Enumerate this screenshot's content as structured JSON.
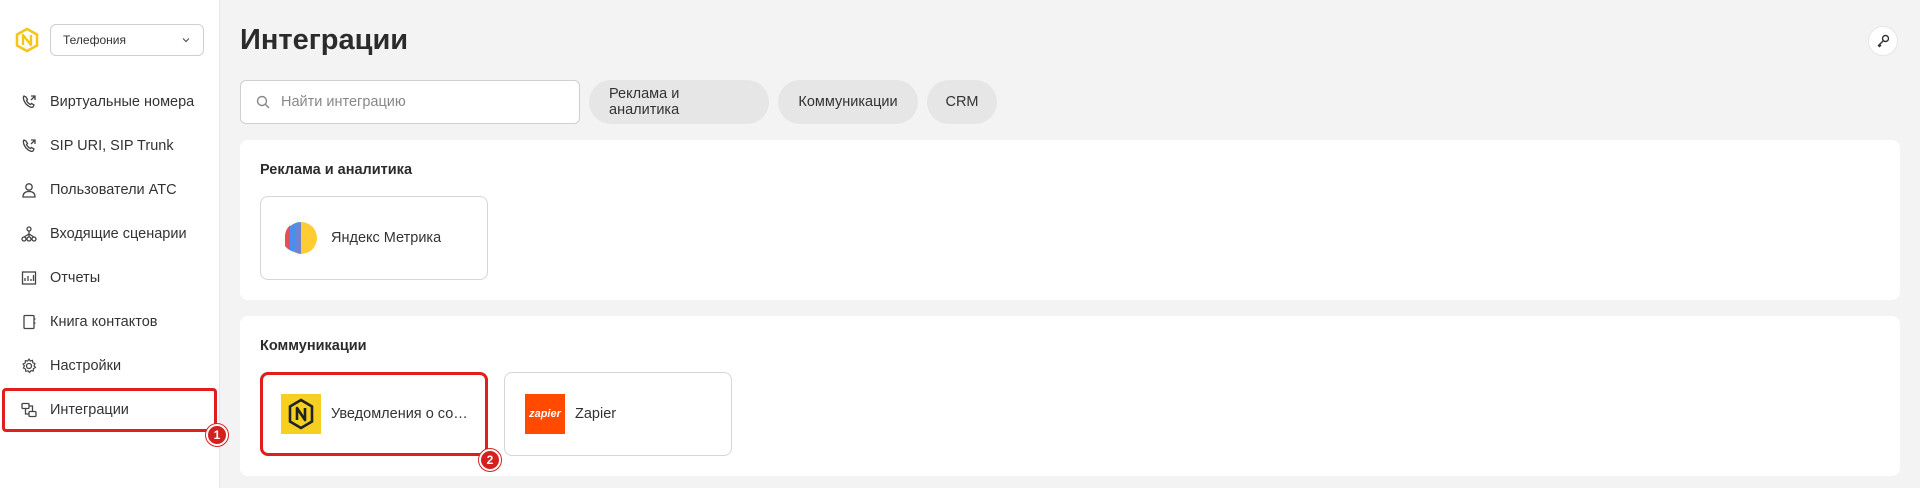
{
  "sidebar": {
    "department_select": "Телефония",
    "items": [
      {
        "label": "Виртуальные номера",
        "icon": "phone-forward-icon"
      },
      {
        "label": "SIP URI, SIP Trunk",
        "icon": "phone-forward-icon"
      },
      {
        "label": "Пользователи АТС",
        "icon": "user-icon"
      },
      {
        "label": "Входящие сценарии",
        "icon": "flow-icon"
      },
      {
        "label": "Отчеты",
        "icon": "chart-icon"
      },
      {
        "label": "Книга контактов",
        "icon": "contact-book-icon"
      },
      {
        "label": "Настройки",
        "icon": "gear-icon"
      },
      {
        "label": "Интеграции",
        "icon": "integrations-icon",
        "active": true
      }
    ]
  },
  "header": {
    "title": "Интеграции"
  },
  "search": {
    "placeholder": "Найти интеграцию"
  },
  "filters": [
    "Реклама и аналитика",
    "Коммуникации",
    "CRM"
  ],
  "sections": [
    {
      "title": "Реклама и аналитика",
      "cards": [
        {
          "label": "Яндекс Метрика",
          "icon": "yandex-metrika-logo"
        }
      ]
    },
    {
      "title": "Коммуникации",
      "cards": [
        {
          "label": "Уведомления о событиях",
          "icon": "novofon-logo"
        },
        {
          "label": "Zapier",
          "icon": "zapier-logo",
          "logo_text": "zapier"
        }
      ]
    }
  ],
  "annotations": [
    "1",
    "2"
  ],
  "colors": {
    "accent": "#f5c518",
    "highlight": "#e01e1e",
    "zapier": "#ff4a00"
  }
}
